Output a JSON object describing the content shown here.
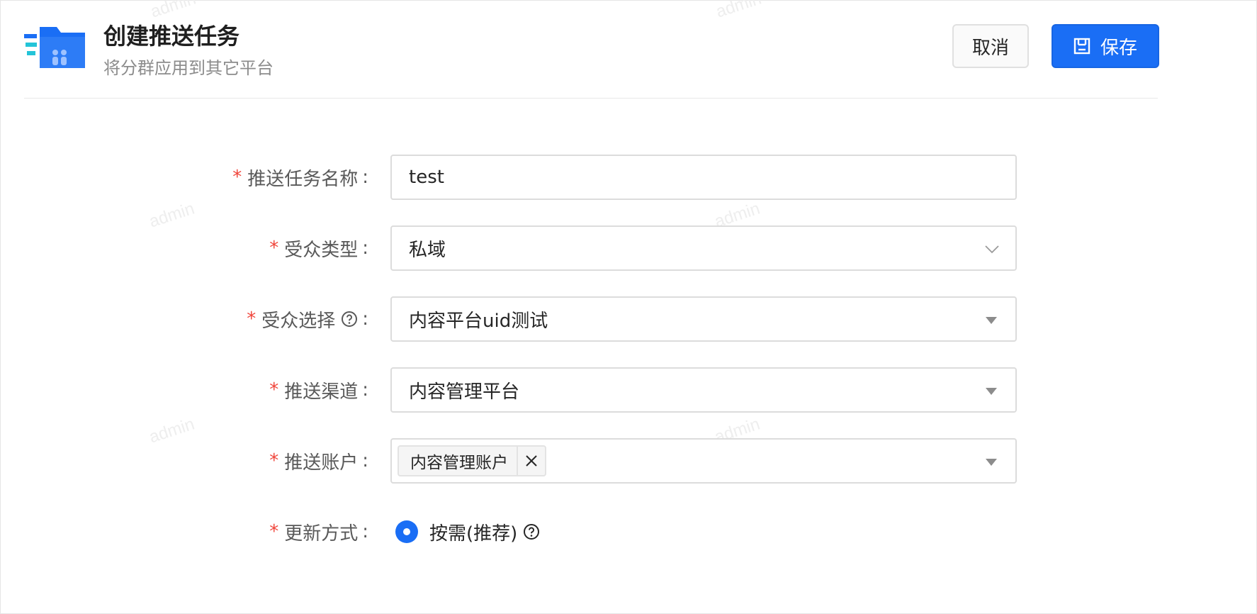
{
  "header": {
    "title": "创建推送任务",
    "subtitle": "将分群应用到其它平台",
    "cancel_label": "取消",
    "save_label": "保存",
    "accent_color": "#1a6ef5"
  },
  "watermark_text": "admin",
  "form": {
    "task_name": {
      "label": "推送任务名称",
      "value": "test",
      "required": true
    },
    "audience_type": {
      "label": "受众类型",
      "value": "私域",
      "required": true,
      "icon": "chevron-down-icon"
    },
    "audience_select": {
      "label": "受众选择",
      "value": "内容平台uid测试",
      "required": true,
      "help_icon": "question-circle-icon"
    },
    "push_channel": {
      "label": "推送渠道",
      "value": "内容管理平台",
      "required": true
    },
    "push_account": {
      "label": "推送账户",
      "tags": [
        "内容管理账户"
      ],
      "required": true
    },
    "update_mode": {
      "label": "更新方式",
      "option_label": "按需(推荐)",
      "selected": true,
      "required": true,
      "help_icon": "question-circle-icon"
    }
  }
}
